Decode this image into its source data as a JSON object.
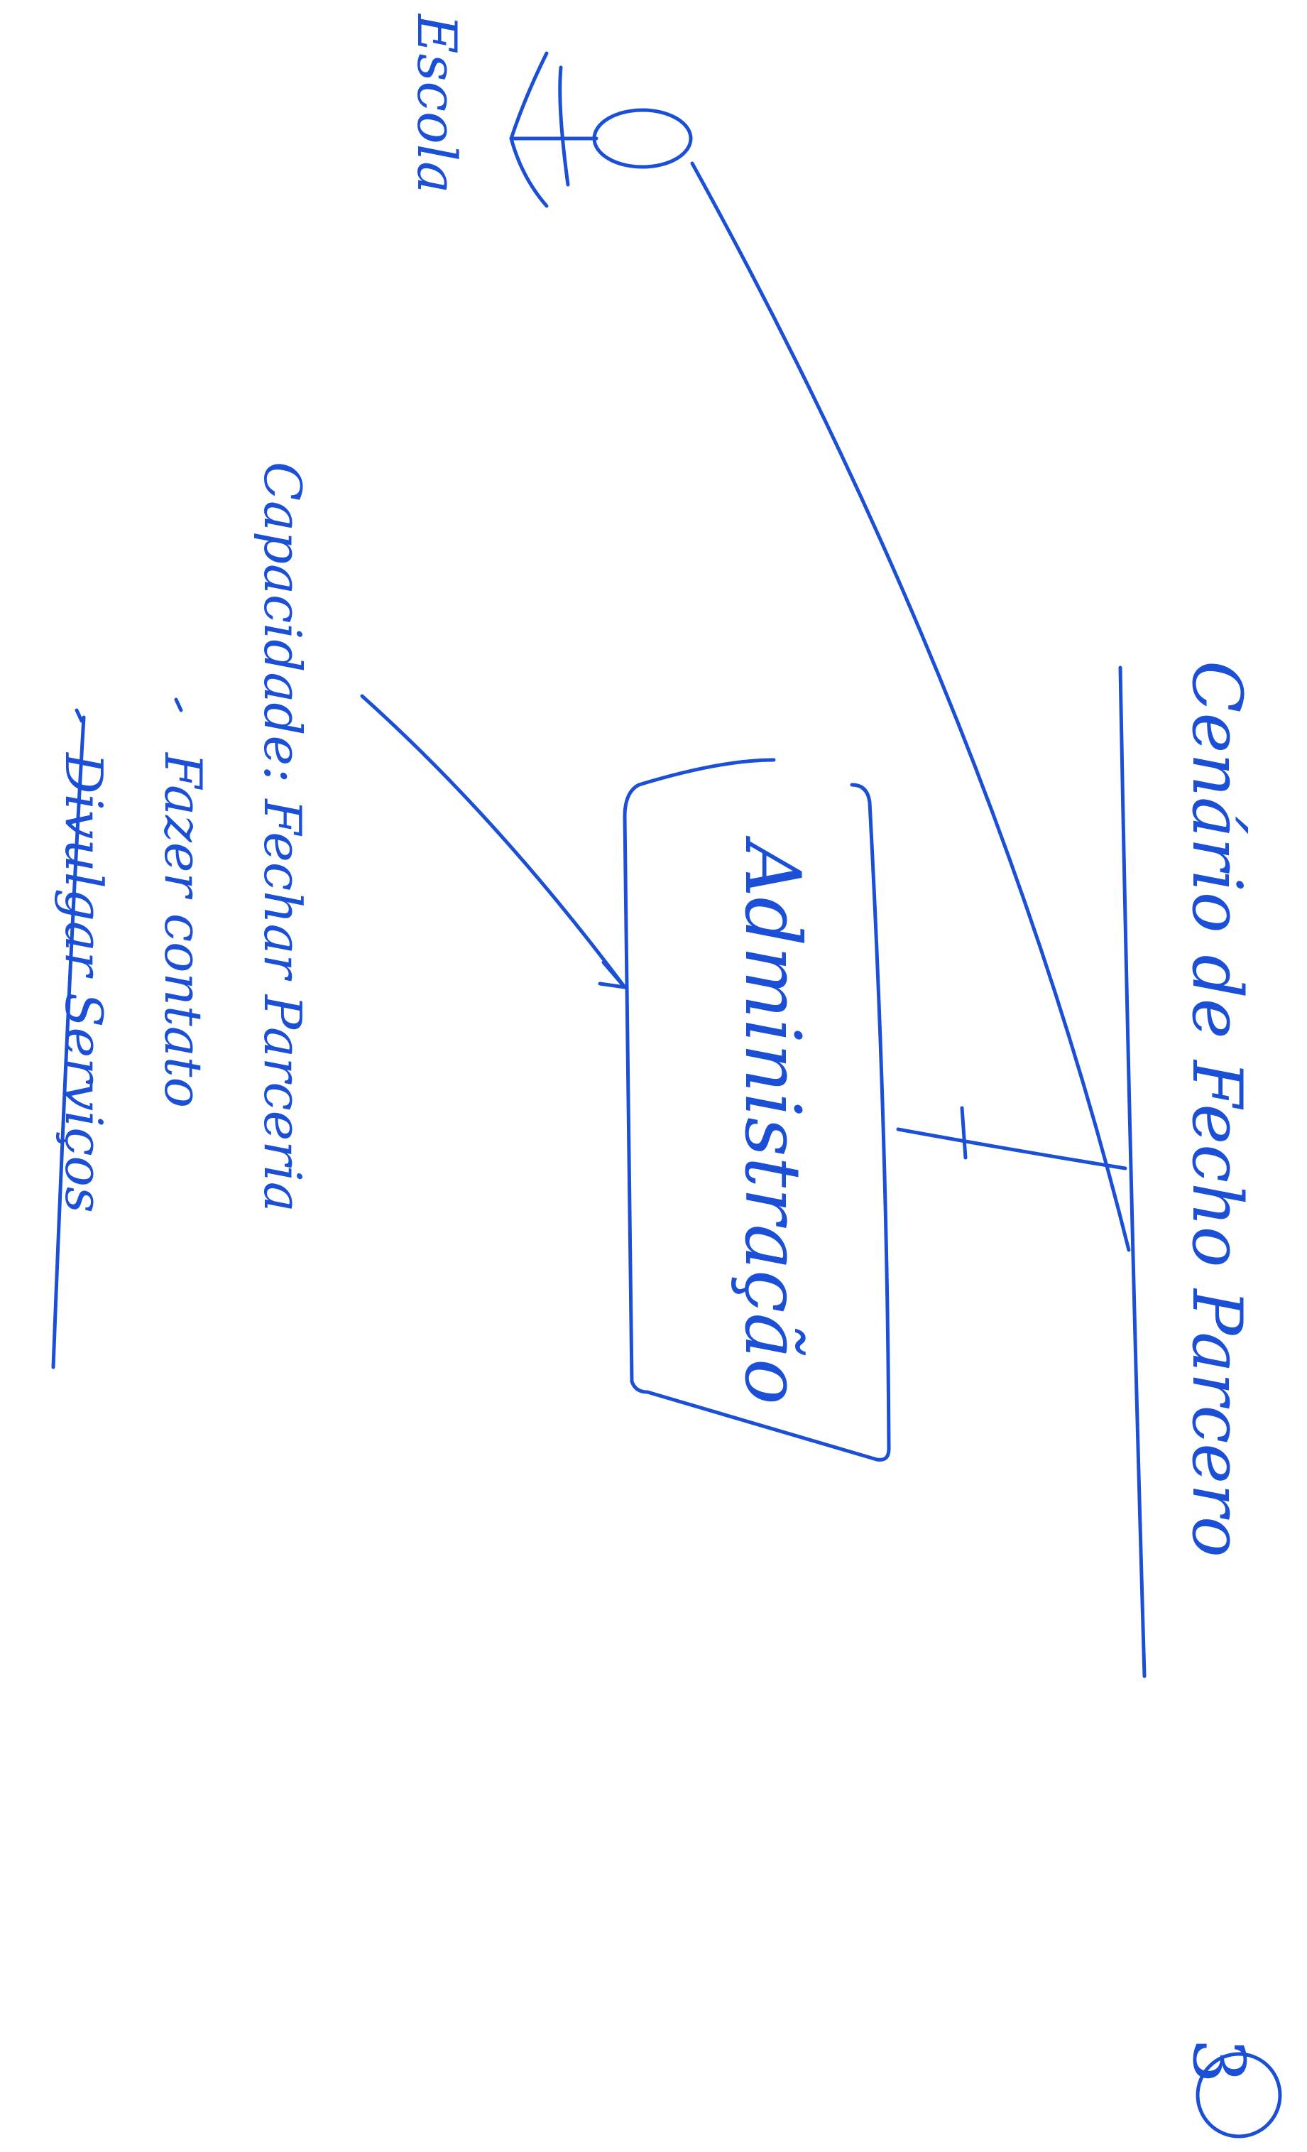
{
  "diagram": {
    "title": "Cenário de Fecho Parcero",
    "central_node": "Administração",
    "actors": [
      {
        "label": "Escola"
      }
    ],
    "capability": {
      "label": "Capacidade: Fechar Parceria",
      "items": [
        "Fazer contato",
        "Divulgar Serviços"
      ]
    },
    "page_number": "3"
  },
  "colors": {
    "ink": "#1a4fd6",
    "paper": "#ffffff"
  }
}
